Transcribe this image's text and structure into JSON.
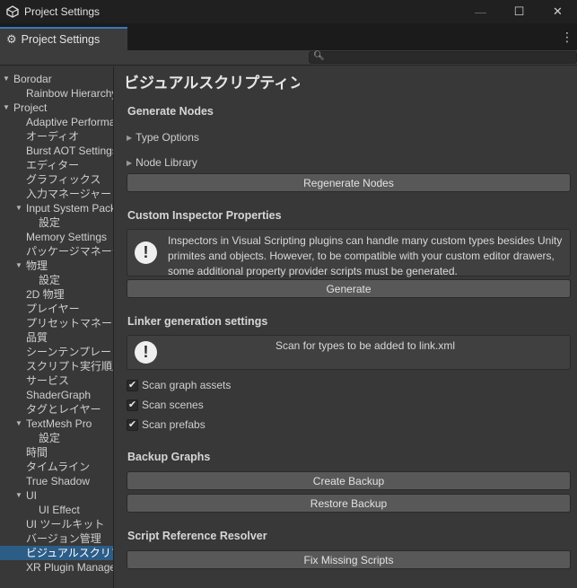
{
  "window": {
    "title": "Project Settings",
    "controls": [
      "—",
      "☐",
      "✕"
    ]
  },
  "tab": {
    "label": "Project Settings",
    "menu_glyph": "⋮"
  },
  "search": {
    "placeholder": "",
    "icon": "search-icon"
  },
  "sidebar": {
    "items": [
      {
        "label": "Borodar",
        "indent": 0,
        "arrow": "▼"
      },
      {
        "label": "Rainbow Hierarchy",
        "indent": 2,
        "arrow": ""
      },
      {
        "label": "Project",
        "indent": 0,
        "arrow": "▼"
      },
      {
        "label": "Adaptive Performance",
        "indent": 2,
        "arrow": ""
      },
      {
        "label": "オーディオ",
        "indent": 2,
        "arrow": ""
      },
      {
        "label": "Burst AOT Settings",
        "indent": 2,
        "arrow": ""
      },
      {
        "label": "エディター",
        "indent": 2,
        "arrow": ""
      },
      {
        "label": "グラフィックス",
        "indent": 2,
        "arrow": ""
      },
      {
        "label": "入力マネージャー",
        "indent": 2,
        "arrow": ""
      },
      {
        "label": "Input System Package",
        "indent": 2,
        "arrow": "▼"
      },
      {
        "label": "設定",
        "indent": 3,
        "arrow": ""
      },
      {
        "label": "Memory Settings",
        "indent": 2,
        "arrow": ""
      },
      {
        "label": "パッケージマネージャー",
        "indent": 2,
        "arrow": ""
      },
      {
        "label": "物理",
        "indent": 2,
        "arrow": "▼"
      },
      {
        "label": "設定",
        "indent": 3,
        "arrow": ""
      },
      {
        "label": "2D 物理",
        "indent": 2,
        "arrow": ""
      },
      {
        "label": "プレイヤー",
        "indent": 2,
        "arrow": ""
      },
      {
        "label": "プリセットマネージャー",
        "indent": 2,
        "arrow": ""
      },
      {
        "label": "品質",
        "indent": 2,
        "arrow": ""
      },
      {
        "label": "シーンテンプレート",
        "indent": 2,
        "arrow": ""
      },
      {
        "label": "スクリプト実行順序",
        "indent": 2,
        "arrow": ""
      },
      {
        "label": "サービス",
        "indent": 2,
        "arrow": ""
      },
      {
        "label": "ShaderGraph",
        "indent": 2,
        "arrow": ""
      },
      {
        "label": "タグとレイヤー",
        "indent": 2,
        "arrow": ""
      },
      {
        "label": "TextMesh Pro",
        "indent": 2,
        "arrow": "▼"
      },
      {
        "label": "設定",
        "indent": 3,
        "arrow": ""
      },
      {
        "label": "時間",
        "indent": 2,
        "arrow": ""
      },
      {
        "label": "タイムライン",
        "indent": 2,
        "arrow": ""
      },
      {
        "label": "True Shadow",
        "indent": 2,
        "arrow": ""
      },
      {
        "label": "UI",
        "indent": 2,
        "arrow": "▼"
      },
      {
        "label": "UI Effect",
        "indent": 3,
        "arrow": ""
      },
      {
        "label": "UI ツールキット",
        "indent": 2,
        "arrow": ""
      },
      {
        "label": "バージョン管理",
        "indent": 2,
        "arrow": ""
      },
      {
        "label": "ビジュアルスクリプティング",
        "indent": 2,
        "arrow": "",
        "selected": true
      },
      {
        "label": "XR Plugin Management",
        "indent": 2,
        "arrow": ""
      }
    ]
  },
  "main": {
    "title": "ビジュアルスクリプティング",
    "generate_nodes": {
      "heading": "Generate Nodes",
      "type_options": "Type Options",
      "node_library": "Node Library",
      "regenerate": "Regenerate Nodes"
    },
    "custom_inspector": {
      "heading": "Custom Inspector Properties",
      "help": "Inspectors in Visual Scripting plugins can handle many custom types besides Unity primites and objects. However, to be compatible with your custom editor drawers, some additional property provider scripts must be generated.",
      "generate": "Generate"
    },
    "linker": {
      "heading": "Linker generation settings",
      "help": "Scan for types to be added to link.xml",
      "scan_graph_assets": "Scan graph assets",
      "scan_scenes": "Scan scenes",
      "scan_prefabs": "Scan prefabs",
      "checked": "✔"
    },
    "backup": {
      "heading": "Backup Graphs",
      "create": "Create Backup",
      "restore": "Restore Backup"
    },
    "resolver": {
      "heading": "Script Reference Resolver",
      "fix": "Fix Missing Scripts"
    },
    "help_glyph": "!"
  },
  "colors": {
    "accent": "#3a79bb",
    "selection": "#2c5d87",
    "background": "#383838"
  }
}
